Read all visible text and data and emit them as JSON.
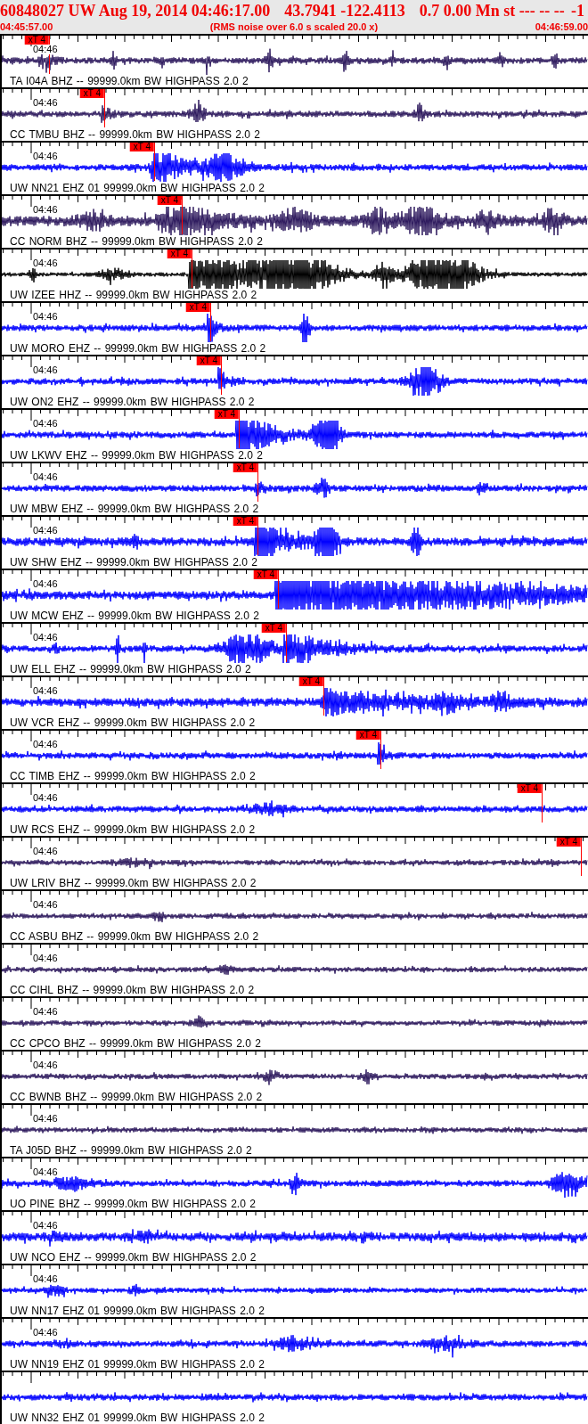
{
  "header": {
    "title_parts": [
      "60848027 UW Aug 19, 2014 04:46:17.00",
      "43.7941 -122.4113",
      "0.7 0.00 Mn st --- -- --",
      "-1"
    ],
    "start_time": "04:45:57.00",
    "note": "(RMS noise over 6.0 s scaled 20.0 x)",
    "end_time": "04:46:59.00"
  },
  "traces": [
    {
      "label": "TA I04A BHZ -- 99999.0km BW HIGHPASS 2.0 2",
      "time_label": "04:46",
      "color": "#2e1a5e",
      "pick": {
        "label": "xT 4"
      }
    },
    {
      "label": "CC TMBU BHZ -- 99999.0km BW HIGHPASS 2.0 2",
      "time_label": "04:46",
      "color": "#2e1a5e",
      "pick": {
        "label": "xT 4"
      }
    },
    {
      "label": "UW NN21 EHZ 01 99999.0km BW HIGHPASS 2.0 2",
      "time_label": "04:46",
      "color": "#0000ff",
      "pick": {
        "label": "xT 4"
      }
    },
    {
      "label": "CC NORM BHZ -- 99999.0km BW HIGHPASS 2.0 2",
      "time_label": "04:46",
      "color": "#2e1a5e",
      "pick": {
        "label": "xT 4"
      }
    },
    {
      "label": "UW IZEE HHZ -- 99999.0km BW HIGHPASS 2.0 2",
      "time_label": "04:46",
      "color": "#000000",
      "pick": {
        "label": "xT 4"
      }
    },
    {
      "label": "UW MORO EHZ -- 99999.0km BW HIGHPASS 2.0 2",
      "time_label": "04:46",
      "color": "#0000ff",
      "pick": {
        "label": "xT 4"
      }
    },
    {
      "label": "UW ON2 EHZ -- 99999.0km BW HIGHPASS 2.0 2",
      "time_label": "04:46",
      "color": "#0000ff",
      "pick": {
        "label": "xT 4"
      }
    },
    {
      "label": "UW LKWV EHZ -- 99999.0km BW HIGHPASS 2.0 2",
      "time_label": "04:46",
      "color": "#0000ff",
      "pick": {
        "label": "xT 4"
      }
    },
    {
      "label": "UW MBW EHZ -- 99999.0km BW HIGHPASS 2.0 2",
      "time_label": "04:46",
      "color": "#0000ff",
      "pick": {
        "label": "xT 4"
      }
    },
    {
      "label": "UW SHW EHZ -- 99999.0km BW HIGHPASS 2.0 2",
      "time_label": "04:46",
      "color": "#0000ff",
      "pick": {
        "label": "xT 4"
      }
    },
    {
      "label": "UW MCW EHZ -- 99999.0km BW HIGHPASS 2.0 2",
      "time_label": "04:46",
      "color": "#0000ff",
      "pick": {
        "label": "xT 4"
      }
    },
    {
      "label": "UW ELL EHZ -- 99999.0km BW HIGHPASS 2.0 2",
      "time_label": "04:46",
      "color": "#0000ff",
      "pick": {
        "label": "xT 4"
      }
    },
    {
      "label": "UW VCR EHZ -- 99999.0km BW HIGHPASS 2.0 2",
      "time_label": "04:46",
      "color": "#0000ff",
      "pick": {
        "label": "xT 4"
      }
    },
    {
      "label": "CC TIMB EHZ -- 99999.0km BW HIGHPASS 2.0 2",
      "time_label": "04:46",
      "color": "#0000ff",
      "pick": {
        "label": "xT 4"
      }
    },
    {
      "label": "UW RCS EHZ -- 99999.0km BW HIGHPASS 2.0 2",
      "time_label": "04:46",
      "color": "#0000ff",
      "pick": {
        "label": "xT 4"
      }
    },
    {
      "label": "UW LRIV BHZ -- 99999.0km BW HIGHPASS 2.0 2",
      "time_label": "04:46",
      "color": "#2e1a5e",
      "pick": {
        "label": "xT 4"
      }
    },
    {
      "label": "CC ASBU BHZ -- 99999.0km BW HIGHPASS 2.0 2",
      "time_label": "04:46",
      "color": "#2e1a5e"
    },
    {
      "label": "CC CIHL BHZ -- 99999.0km BW HIGHPASS 2.0 2",
      "time_label": "04:46",
      "color": "#2e1a5e"
    },
    {
      "label": "CC CPCO BHZ -- 99999.0km BW HIGHPASS 2.0 2",
      "time_label": "04:46",
      "color": "#2e1a5e"
    },
    {
      "label": "CC BWNB BHZ -- 99999.0km BW HIGHPASS 2.0 2",
      "time_label": "04:46",
      "color": "#2e1a5e"
    },
    {
      "label": "TA J05D BHZ -- 99999.0km BW HIGHPASS 2.0 2",
      "time_label": "04:46",
      "color": "#2e1a5e"
    },
    {
      "label": "UO PINE BHZ -- 99999.0km BW HIGHPASS 2.0 2",
      "time_label": "04:46",
      "color": "#0000ff"
    },
    {
      "label": "UW NCO EHZ -- 99999.0km BW HIGHPASS 2.0 2",
      "time_label": "04:46",
      "color": "#0000ff"
    },
    {
      "label": "UW NN17 EHZ 01 99999.0km BW HIGHPASS 2.0 2",
      "time_label": "04:46",
      "color": "#0000ff"
    },
    {
      "label": "UW NN19 EHZ 01 99999.0km BW HIGHPASS 2.0 2",
      "time_label": "04:46",
      "color": "#0000ff"
    },
    {
      "label": "UW NN32 EHZ 01 99999.0km BW HIGHPASS 2.0 2",
      "color": "#0000ff"
    }
  ]
}
